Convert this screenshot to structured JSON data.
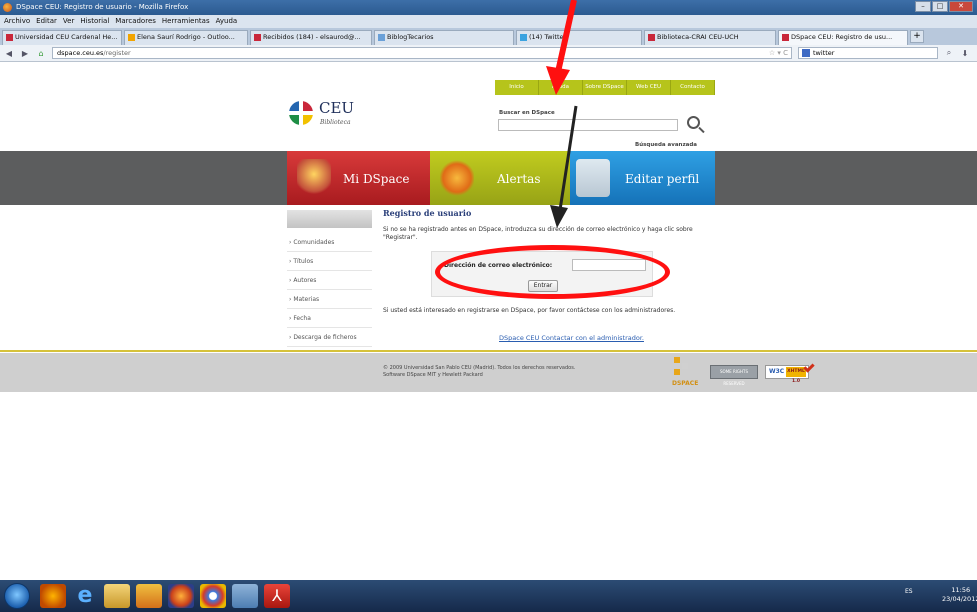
{
  "browser": {
    "title": "DSpace CEU: Registro de usuario - Mozilla Firefox",
    "menu": [
      "Archivo",
      "Editar",
      "Ver",
      "Historial",
      "Marcadores",
      "Herramientas",
      "Ayuda"
    ],
    "tabs": [
      {
        "label": "Universidad CEU Cardenal He...",
        "color": "#c9273a"
      },
      {
        "label": "Elena Saurí Rodrigo - Outloo...",
        "color": "#f2a400"
      },
      {
        "label": "Recibidos (184) - elsaurod@...",
        "color": "#c9273a"
      },
      {
        "label": "BiblogTecarios",
        "color": "#6aa0d8"
      },
      {
        "label": "(14) Twitter",
        "color": "#3ba3e0"
      },
      {
        "label": "Biblioteca-CRAI CEU-UCH",
        "color": "#c9273a"
      },
      {
        "label": "DSpace CEU: Registro de usu...",
        "color": "#c9273a"
      }
    ],
    "url_domain": "dspace.ceu.es",
    "url_path": "/register",
    "search_value": "twitter"
  },
  "site": {
    "logo_name": "CEU",
    "logo_sub": "Biblioteca",
    "topnav": [
      "Inicio",
      "Ayuda",
      "Sobre DSpace",
      "Web CEU",
      "Contacto"
    ],
    "search_label": "Buscar en DSpace",
    "advanced_search": "Búsqueda avanzada",
    "tiles": {
      "mi": "Mi DSpace",
      "alert": "Alertas",
      "edit": "Editar perfil"
    }
  },
  "sidebar": {
    "items": [
      "Comunidades",
      "Títulos",
      "Autores",
      "Materias",
      "Fecha",
      "Descarga de ficheros"
    ]
  },
  "main": {
    "heading": "Registro de usuario",
    "intro": "Si no se ha registrado antes en DSpace, introduzca su dirección de correo electrónico y haga clic sobre \"Registrar\".",
    "email_label": "Dirección de correo electrónico:",
    "email_value": "",
    "enter_button": "Entrar",
    "outro": "Si usted está interesado en registrarse en DSpace, por favor contáctese con los administradores.",
    "contact_link": "DSpace CEU Contactar con el administrador."
  },
  "footer": {
    "line1": "© 2009 Universidad San Pablo CEU (Madrid). Todos los derechos reservados.",
    "line2": "Software DSpace MIT y Hewlett Packard",
    "dspace_logo_text": "DSPACE",
    "cc_badge": "SOME RIGHTS RESERVED",
    "w3c_badge": "W3C",
    "xhtml_badge": "XHTML 1.0"
  },
  "taskbar": {
    "tray": "ES",
    "time": "11:56",
    "date": "23/04/2012"
  },
  "colors": {
    "annotation": "#ff1010",
    "tile_mi": "#c92a2e",
    "tile_alert": "#aab419",
    "tile_edit": "#1f86cf"
  }
}
